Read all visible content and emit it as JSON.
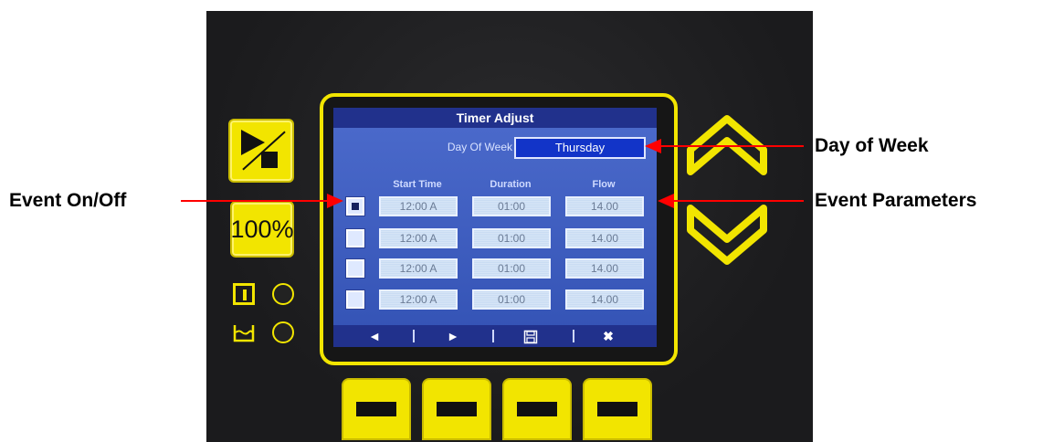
{
  "screen": {
    "title": "Timer Adjust",
    "day_of_week_label": "Day Of Week",
    "day_of_week_value": "Thursday",
    "columns": [
      "Start Time",
      "Duration",
      "Flow"
    ],
    "events": [
      {
        "enabled": true,
        "start": "12:00 A",
        "duration": "01:00",
        "flow": "14.00"
      },
      {
        "enabled": false,
        "start": "12:00 A",
        "duration": "01:00",
        "flow": "14.00"
      },
      {
        "enabled": false,
        "start": "12:00 A",
        "duration": "01:00",
        "flow": "14.00"
      },
      {
        "enabled": false,
        "start": "12:00 A",
        "duration": "01:00",
        "flow": "14.00"
      }
    ],
    "nav_buttons": {
      "prev": "◄",
      "next": "►",
      "save": "💾",
      "cancel": "✖"
    }
  },
  "device": {
    "percent_button": "100%",
    "icons": [
      "play-stop-icon",
      "pump-indicator-icon",
      "tank-indicator-icon",
      "chevron-up-icon",
      "chevron-down-icon"
    ]
  },
  "annotations": {
    "event_on_off": "Event On/Off",
    "day_of_week": "Day of Week",
    "event_parameters": "Event Parameters"
  },
  "colors": {
    "accent_yellow": "#f2e500",
    "screen_blue": "#3f5fc0",
    "annotation_red": "#ff0000"
  }
}
